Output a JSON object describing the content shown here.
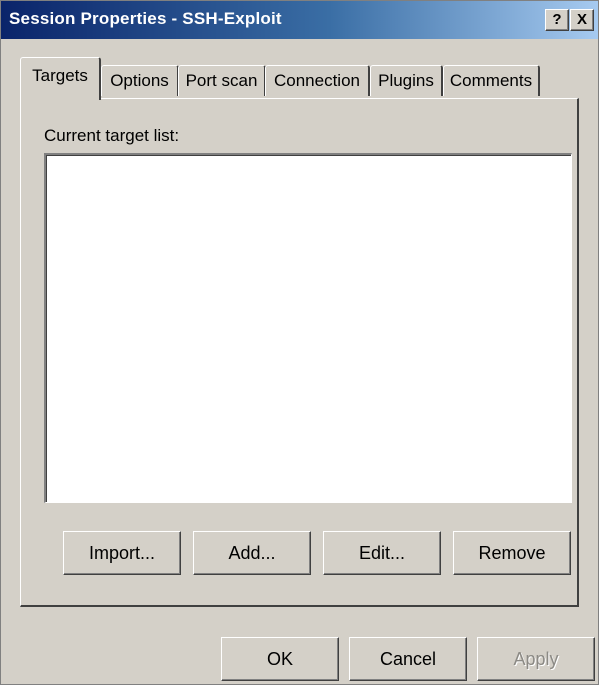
{
  "window": {
    "title": "Session Properties - SSH-Exploit",
    "help_glyph": "?",
    "close_glyph": "X"
  },
  "tabs": [
    {
      "label": "Targets",
      "active": true
    },
    {
      "label": "Options",
      "active": false
    },
    {
      "label": "Port scan",
      "active": false
    },
    {
      "label": "Connection",
      "active": false
    },
    {
      "label": "Plugins",
      "active": false
    },
    {
      "label": "Comments",
      "active": false
    }
  ],
  "targets_panel": {
    "list_label": "Current target list:",
    "items": [],
    "buttons": {
      "import": "Import...",
      "add": "Add...",
      "edit": "Edit...",
      "remove": "Remove"
    }
  },
  "footer": {
    "ok": "OK",
    "cancel": "Cancel",
    "apply": "Apply",
    "apply_enabled": false
  }
}
